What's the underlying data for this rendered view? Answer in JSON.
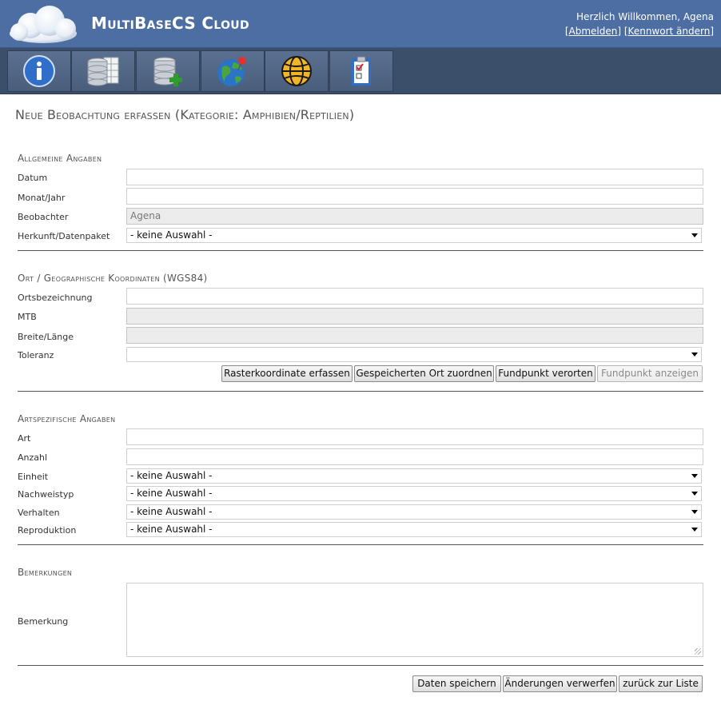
{
  "header": {
    "app_title": "MultiBaseCS Cloud",
    "welcome_text": "Herzlich Willkommen, Agena",
    "logout_link": "[Abmelden]",
    "change_password_link": "[Kennwort ändern]",
    "brand_color": "#4d6ea3"
  },
  "toolbar": {
    "buttons": [
      {
        "icon": "info-icon"
      },
      {
        "icon": "database-table-icon"
      },
      {
        "icon": "database-add-icon"
      },
      {
        "icon": "globe-pin-icon"
      },
      {
        "icon": "globe-grid-icon"
      },
      {
        "icon": "clipboard-checklist-icon"
      }
    ]
  },
  "page": {
    "title": "Neue Beobachtung erfassen (Kategorie: Amphibien/Reptilien)"
  },
  "general": {
    "section_title": "Allgemeine Angaben",
    "datum_label": "Datum",
    "datum_value": "",
    "monat_label": "Monat/Jahr",
    "monat_value": "",
    "beobachter_label": "Beobachter",
    "beobachter_value": "Agena",
    "herkunft_label": "Herkunft/Datenpaket",
    "herkunft_value": "- keine Auswahl -"
  },
  "location": {
    "section_title": "Ort / Geographische Koordinaten (WGS84)",
    "ort_label": "Ortsbezeichnung",
    "ort_value": "",
    "mtb_label": "MTB",
    "mtb_value": "",
    "breite_label": "Breite/Länge",
    "breite_value": "",
    "toleranz_label": "Toleranz",
    "toleranz_value": "",
    "btn_raster": "Rasterkoordinate erfassen",
    "btn_saved": "Gespeicherten Ort zuordnen",
    "btn_verorten": "Fundpunkt verorten",
    "btn_anzeigen": "Fundpunkt anzeigen"
  },
  "species": {
    "section_title": "Artspezifische Angaben",
    "art_label": "Art",
    "art_value": "",
    "anzahl_label": "Anzahl",
    "anzahl_value": "",
    "einheit_label": "Einheit",
    "einheit_value": "- keine Auswahl -",
    "nachweistyp_label": "Nachweistyp",
    "nachweistyp_value": "- keine Auswahl -",
    "verhalten_label": "Verhalten",
    "verhalten_value": "- keine Auswahl -",
    "reproduktion_label": "Reproduktion",
    "reproduktion_value": "- keine Auswahl -"
  },
  "remarks": {
    "section_title": "Bemerkungen",
    "bemerkung_label": "Bemerkung",
    "bemerkung_value": ""
  },
  "footer": {
    "btn_save": "Daten speichern",
    "btn_discard": "Änderungen verwerfen",
    "btn_back": "zurück zur Liste"
  }
}
